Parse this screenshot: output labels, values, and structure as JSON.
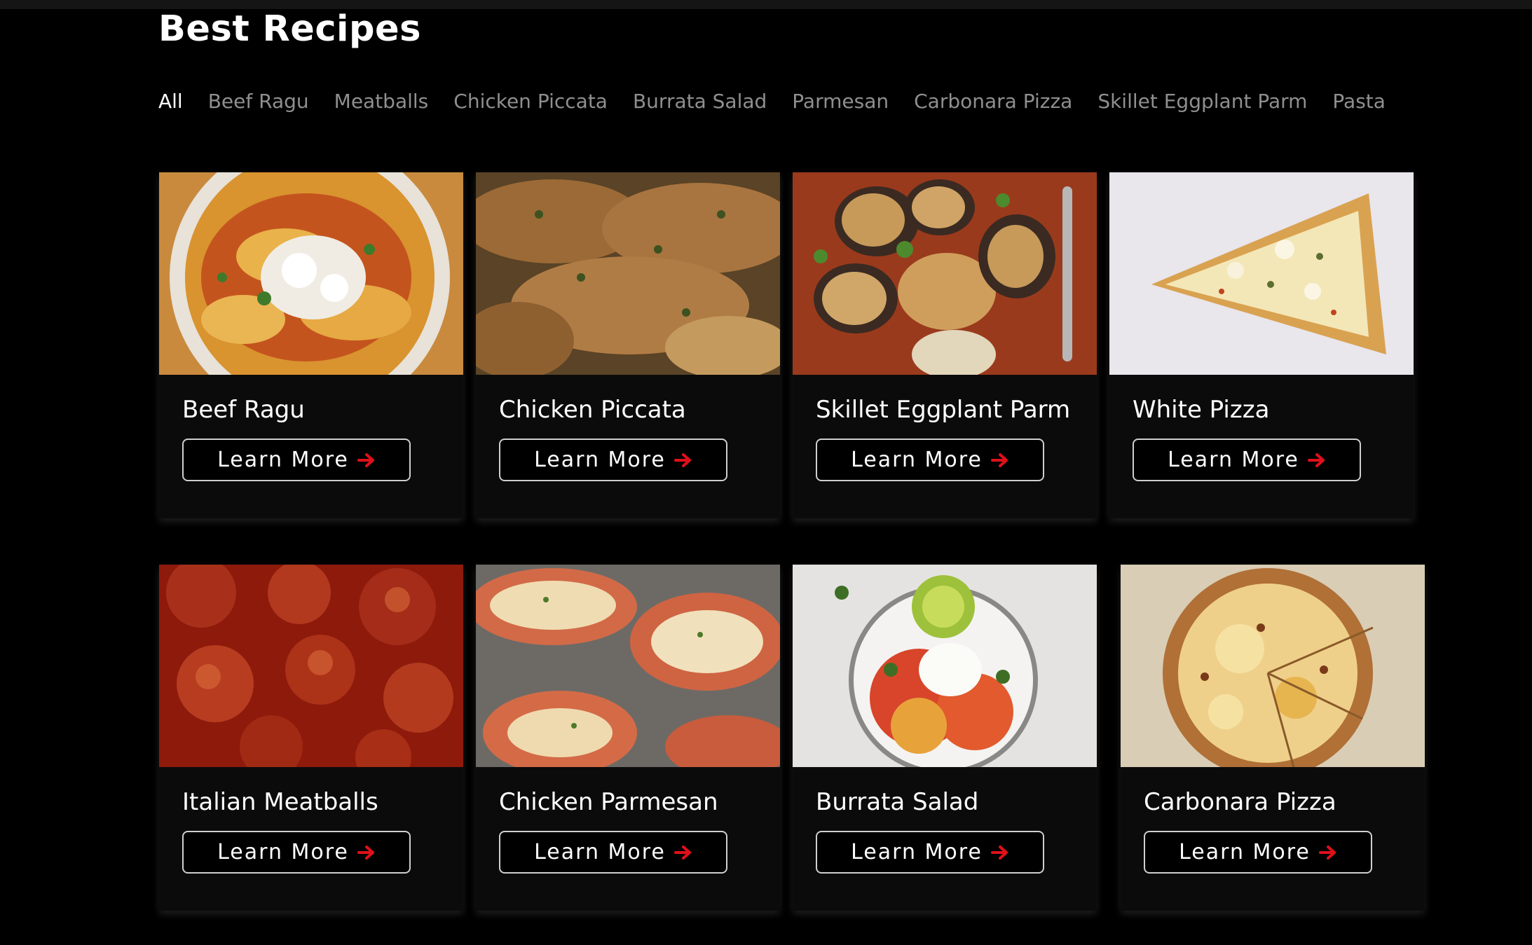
{
  "page": {
    "title": "Best Recipes"
  },
  "filters": [
    {
      "label": "All",
      "active": true
    },
    {
      "label": "Beef Ragu",
      "active": false
    },
    {
      "label": "Meatballs",
      "active": false
    },
    {
      "label": "Chicken Piccata",
      "active": false
    },
    {
      "label": "Burrata Salad",
      "active": false
    },
    {
      "label": "Parmesan",
      "active": false
    },
    {
      "label": "Carbonara Pizza",
      "active": false
    },
    {
      "label": "Skillet Eggplant Parm",
      "active": false
    },
    {
      "label": "Pasta",
      "active": false
    }
  ],
  "cards": [
    {
      "title": "Beef Ragu",
      "button": "Learn More",
      "image": "beef-ragu-photo"
    },
    {
      "title": "Chicken Piccata",
      "button": "Learn More",
      "image": "chicken-piccata-photo"
    },
    {
      "title": "Skillet Eggplant Parm",
      "button": "Learn More",
      "image": "eggplant-parm-photo"
    },
    {
      "title": "White Pizza",
      "button": "Learn More",
      "image": "white-pizza-photo"
    },
    {
      "title": "Italian Meatballs",
      "button": "Learn More",
      "image": "meatballs-photo"
    },
    {
      "title": "Chicken Parmesan",
      "button": "Learn More",
      "image": "chicken-parmesan-photo"
    },
    {
      "title": "Burrata Salad",
      "button": "Learn More",
      "image": "burrata-salad-photo"
    },
    {
      "title": "Carbonara Pizza",
      "button": "Learn More",
      "image": "carbonara-pizza-photo"
    }
  ],
  "colors": {
    "background": "#000000",
    "card": "#0b0b0b",
    "accent_arrow": "#e0101a",
    "filter_inactive": "#8f8f8f",
    "text": "#ffffff"
  },
  "icons": {
    "button_icon": "arrow-right-icon"
  }
}
